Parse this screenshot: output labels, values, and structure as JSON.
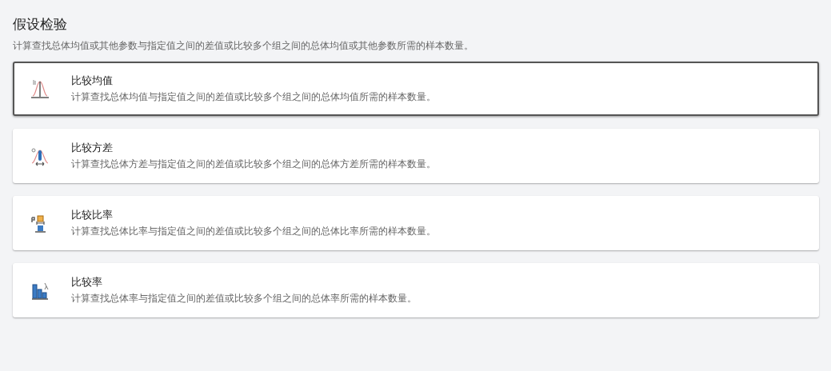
{
  "heading": "假设检验",
  "description": "计算查找总体均值或其他参数与指定值之间的差值或比较多个组之间的总体均值或其他参数所需的样本数量。",
  "options": [
    {
      "kind": "mean",
      "title": "比较均值",
      "text": "计算查找总体均值与指定值之间的差值或比较多个组之间的总体均值所需的样本数量。",
      "selected": true
    },
    {
      "kind": "variance",
      "title": "比较方差",
      "text": "计算查找总体方差与指定值之间的差值或比较多个组之间的总体方差所需的样本数量。",
      "selected": false
    },
    {
      "kind": "proportion",
      "title": "比较比率",
      "text": "计算查找总体比率与指定值之间的差值或比较多个组之间的总体比率所需的样本数量。",
      "selected": false
    },
    {
      "kind": "rate",
      "title": "比较率",
      "text": "计算查找总体率与指定值之间的差值或比较多个组之间的总体率所需的样本数量。",
      "selected": false
    }
  ]
}
